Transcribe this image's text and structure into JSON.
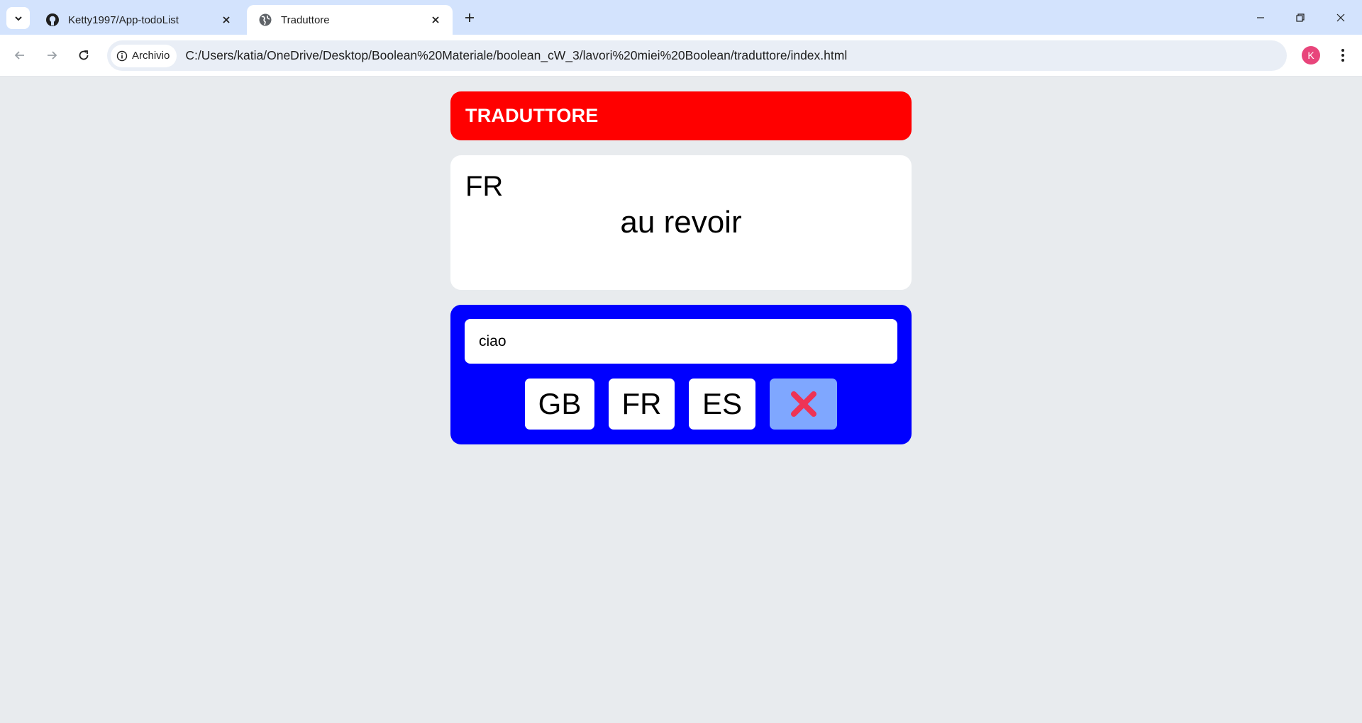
{
  "browser": {
    "tabs": [
      {
        "title": "Ketty1997/App-todoList",
        "active": false,
        "favicon": "github-icon"
      },
      {
        "title": "Traduttore",
        "active": true,
        "favicon": "globe-icon"
      }
    ],
    "omnibox": {
      "chip_label": "Archivio",
      "url": "C:/Users/katia/OneDrive/Desktop/Boolean%20Materiale/boolean_cW_3/lavori%20miei%20Boolean/traduttore/index.html"
    },
    "profile_initial": "K",
    "tab_active_bg": "#ffffff",
    "tabbar_bg": "#d3e3fd"
  },
  "app": {
    "header_title": "TRADUTTORE",
    "result": {
      "language": "FR",
      "translation": "au revoir"
    },
    "input": {
      "value": "ciao"
    },
    "buttons": {
      "gb": "GB",
      "fr": "FR",
      "es": "ES",
      "reset_icon": "close-x-icon"
    },
    "colors": {
      "header": "#ff0000",
      "controls": "#0000ff",
      "reset_button": "#7fa7ff",
      "reset_icon": "#ee3355",
      "page_bg": "#e8ebee"
    }
  }
}
